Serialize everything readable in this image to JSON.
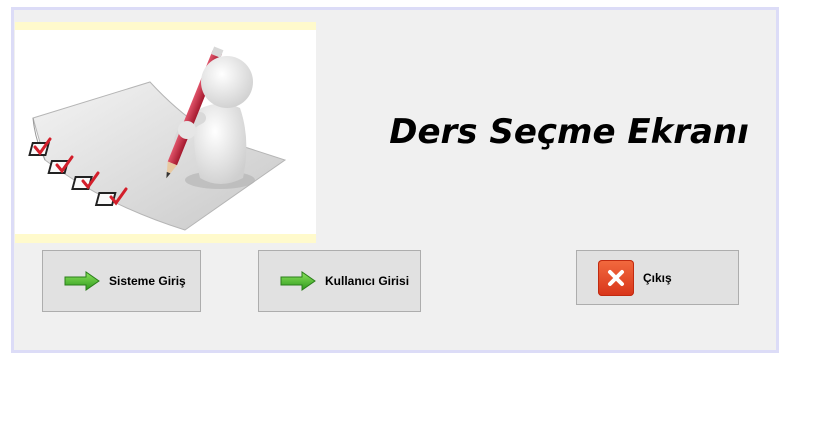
{
  "main": {
    "title": "Ders Seçme Ekranı"
  },
  "buttons": {
    "login_label": "Sisteme Giriş",
    "user_label": "Kullanıcı Girisi",
    "exit_label": "Çıkış"
  },
  "icons": {
    "hero": "checklist-illustration",
    "login": "green-arrow-icon",
    "user": "green-arrow-icon",
    "exit": "red-x-icon"
  },
  "colors": {
    "window_border": "#dcdcf7",
    "window_bg": "#f0f0f0",
    "button_bg": "#e1e1e1",
    "arrow_green": "#3fae2a",
    "exit_red": "#e0431f"
  }
}
